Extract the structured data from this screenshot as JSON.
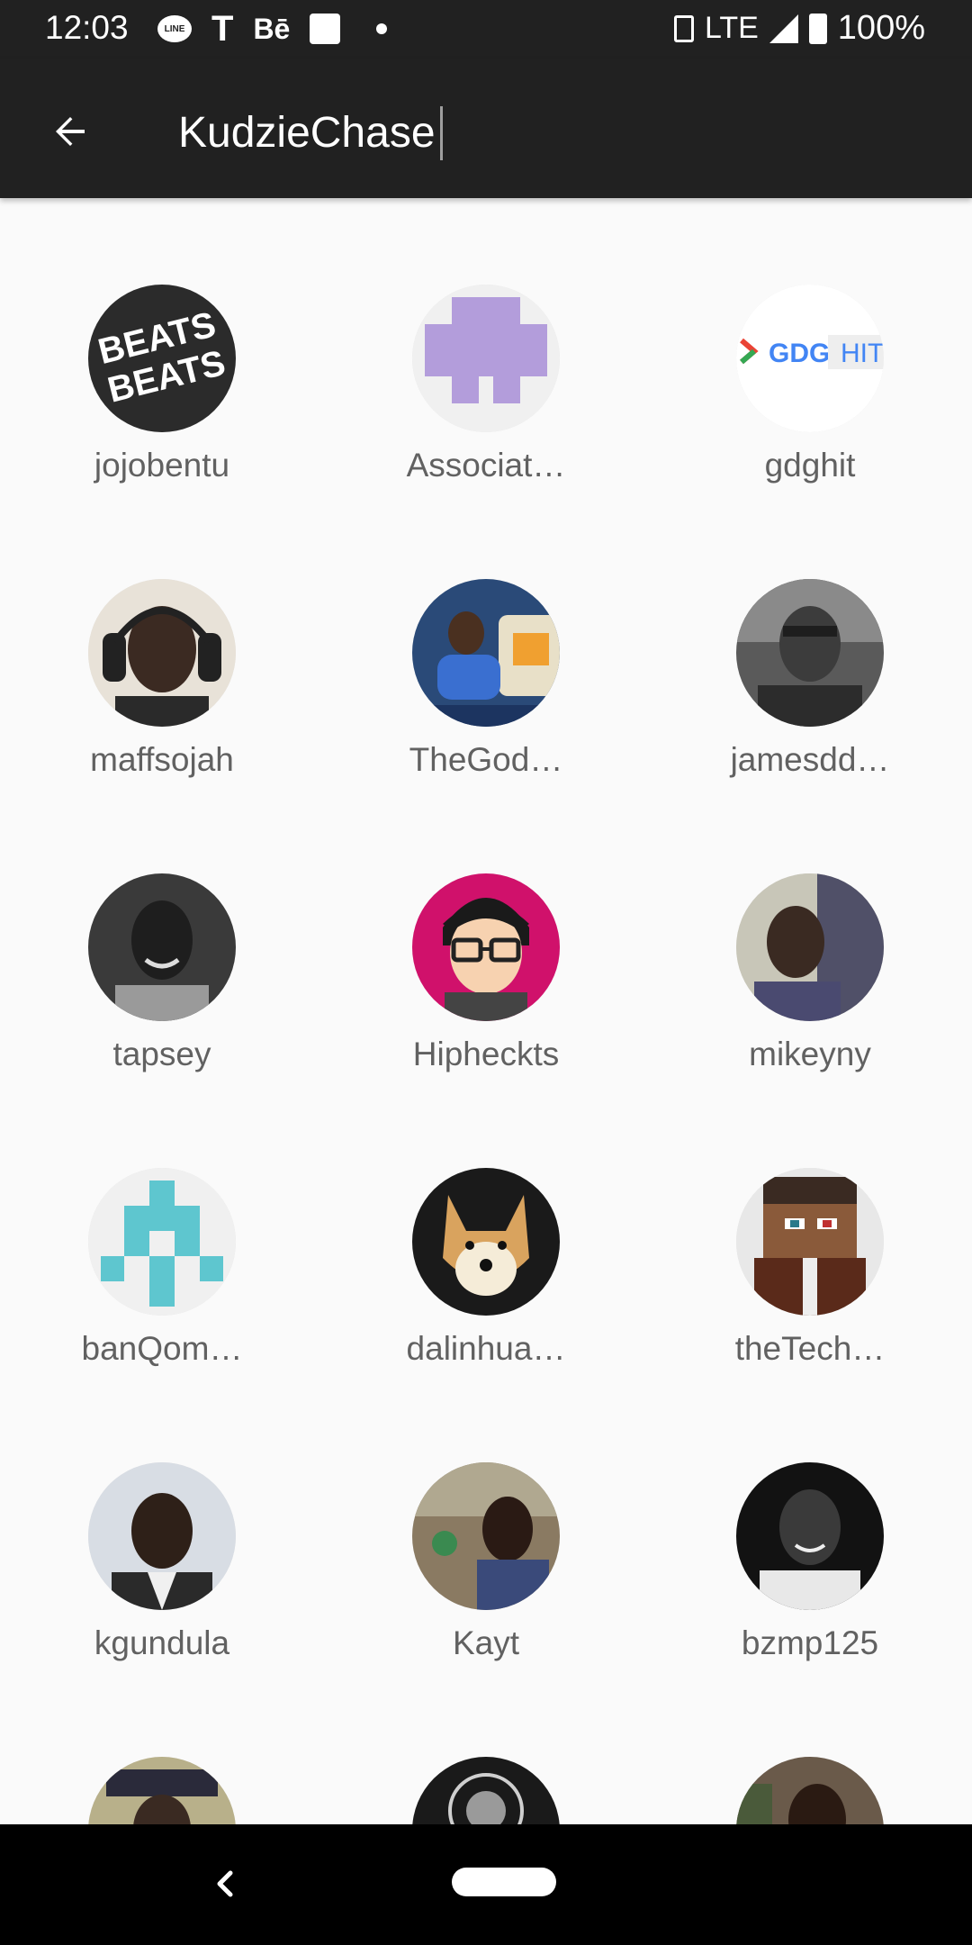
{
  "status_bar": {
    "time": "12:03",
    "network": "LTE",
    "battery": "100%",
    "notif_icons": [
      "line-icon",
      "t-icon",
      "behance-icon",
      "square-icon",
      "dot-icon"
    ],
    "notif_line_label": "LINE",
    "notif_t_label": "T",
    "notif_be_label": "Bē"
  },
  "toolbar": {
    "search_value": "KudzieChase",
    "back_icon": "arrow-left-icon"
  },
  "results": [
    {
      "name": "jojobentu"
    },
    {
      "name": "Associat…"
    },
    {
      "name": "gdghit"
    },
    {
      "name": "maffsojah"
    },
    {
      "name": "TheGod…"
    },
    {
      "name": "jamesdd…"
    },
    {
      "name": "tapsey"
    },
    {
      "name": "Hipheckts"
    },
    {
      "name": "mikeyny"
    },
    {
      "name": "banQom…"
    },
    {
      "name": "dalinhua…"
    },
    {
      "name": "theTech…"
    },
    {
      "name": "kgundula"
    },
    {
      "name": "Kayt"
    },
    {
      "name": "bzmp125"
    },
    {
      "name": ""
    },
    {
      "name": ""
    },
    {
      "name": ""
    }
  ],
  "avatar_texts": {
    "beats_top": "BEATS",
    "beats_bottom": "BEATS",
    "gdg": "GDG",
    "hit": "HIT"
  },
  "colors": {
    "toolbar_bg": "#212121",
    "background": "#fafafa",
    "name_text": "#616161",
    "identicon_purple": "#b39ddb",
    "identicon_teal": "#5ec6cf"
  }
}
